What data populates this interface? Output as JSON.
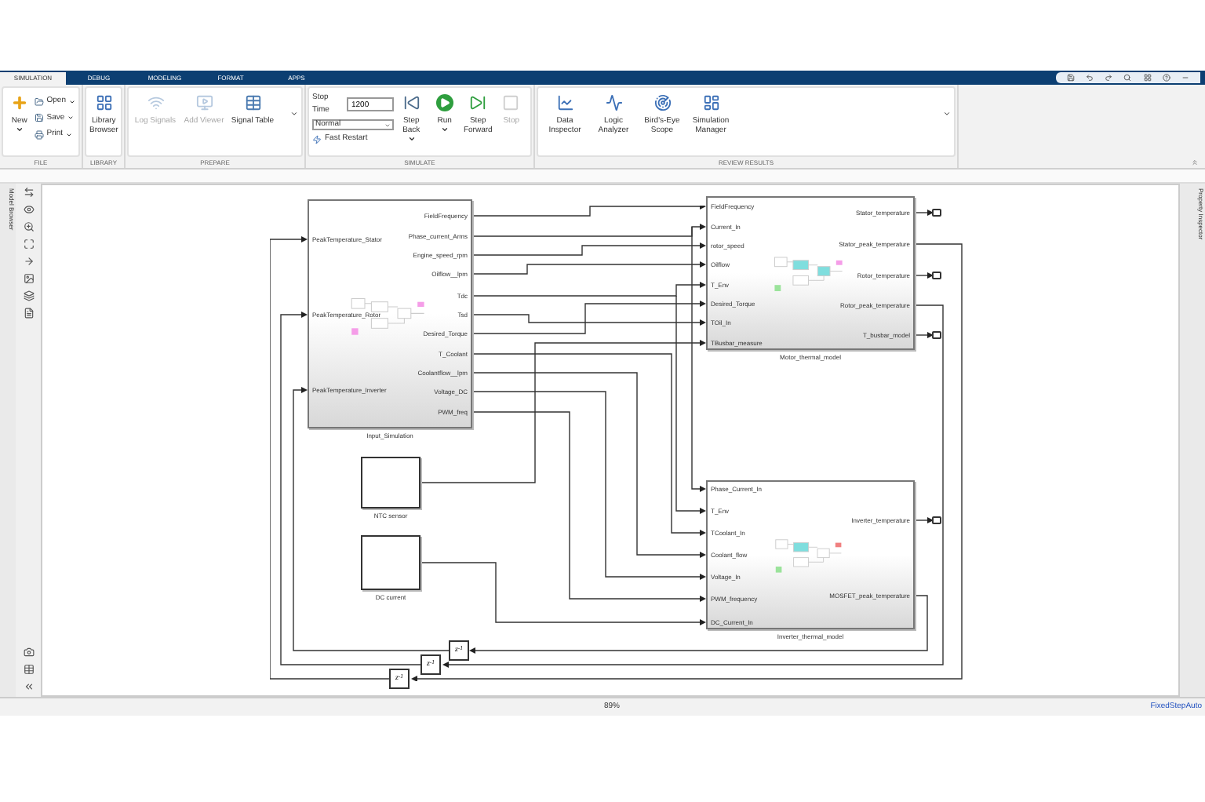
{
  "tabs": [
    {
      "label": "SIMULATION",
      "selected": true
    },
    {
      "label": "DEBUG",
      "selected": false
    },
    {
      "label": "MODELING",
      "selected": false
    },
    {
      "label": "FORMAT",
      "selected": false
    },
    {
      "label": "APPS",
      "selected": false
    }
  ],
  "ribbon": {
    "file": {
      "title": "FILE",
      "items": [
        {
          "label": "New"
        },
        {
          "label": "Open"
        },
        {
          "label": "Save"
        },
        {
          "label": "Print"
        }
      ]
    },
    "library": {
      "title": "LIBRARY",
      "items": [
        {
          "label": "Library Browser"
        }
      ]
    },
    "prepare": {
      "title": "PREPARE",
      "items": [
        {
          "label": "Log Signals",
          "disabled": true
        },
        {
          "label": "Add Viewer",
          "disabled": true
        },
        {
          "label": "Signal Table",
          "disabled": false
        }
      ]
    },
    "simulate": {
      "title": "SIMULATE",
      "stop_time": {
        "label": "Stop Time",
        "value": "1200"
      },
      "mode": {
        "value": "Normal"
      },
      "fast_restart": {
        "label": "Fast Restart"
      },
      "items": [
        {
          "label": "Step Back",
          "disabled": false
        },
        {
          "label": "Run",
          "disabled": false
        },
        {
          "label": "Step Forward",
          "disabled": false
        },
        {
          "label": "Stop",
          "disabled": true
        }
      ]
    },
    "review": {
      "title": "REVIEW RESULTS",
      "items": [
        {
          "label": "Data Inspector"
        },
        {
          "label": "Logic Analyzer"
        },
        {
          "label": "Bird's-Eye Scope"
        },
        {
          "label": "Simulation Manager"
        }
      ]
    }
  },
  "left_panel": {
    "label": "Model Browser"
  },
  "right_panel": {
    "label": "Property Inspector"
  },
  "diagram": {
    "subsystems": [
      {
        "name": "Input_Simulation",
        "inputs": [
          "PeakTemperature_Stator",
          "PeakTemperature_Rotor",
          "PeakTemperature_Inverter"
        ],
        "outputs": [
          "FieldFrequency",
          "Phase_current_Arms",
          "Engine_speed_rpm",
          "Oilflow__lpm",
          "Tdc",
          "Tsd",
          "Desired_Torque",
          "T_Coolant",
          "Coolantflow__lpm",
          "Voltage_DC",
          "PWM_freq"
        ]
      },
      {
        "name": "Motor_thermal_model",
        "inputs": [
          "FieldFrequency",
          "Current_In",
          "rotor_speed",
          "Oilflow",
          "T_Env",
          "Desired_Torque",
          "TOil_In",
          "TBusbar_measure"
        ],
        "outputs": [
          "Stator_temperature",
          "Stator_peak_temperature",
          "Rotor_temperature",
          "Rotor_peak_temperature",
          "T_busbar_model"
        ]
      },
      {
        "name": "Inverter_thermal_model",
        "inputs": [
          "Phase_Current_In",
          "T_Env",
          "TCoolant_In",
          "Coolant_flow",
          "Voltage_In",
          "PWM_frequency",
          "DC_Current_In"
        ],
        "outputs": [
          "Inverter_temperature",
          "MOSFET_peak_temperature"
        ]
      }
    ],
    "blocks": [
      {
        "name": "NTC sensor"
      },
      {
        "name": "DC current"
      }
    ],
    "delays": [
      {
        "label": "z$^{-1}$"
      },
      {
        "label": "z$^{-1}$"
      },
      {
        "label": "z$^{-1}$"
      }
    ]
  },
  "status_bar": {
    "zoom": "89%",
    "solver": "FixedStepAuto"
  }
}
